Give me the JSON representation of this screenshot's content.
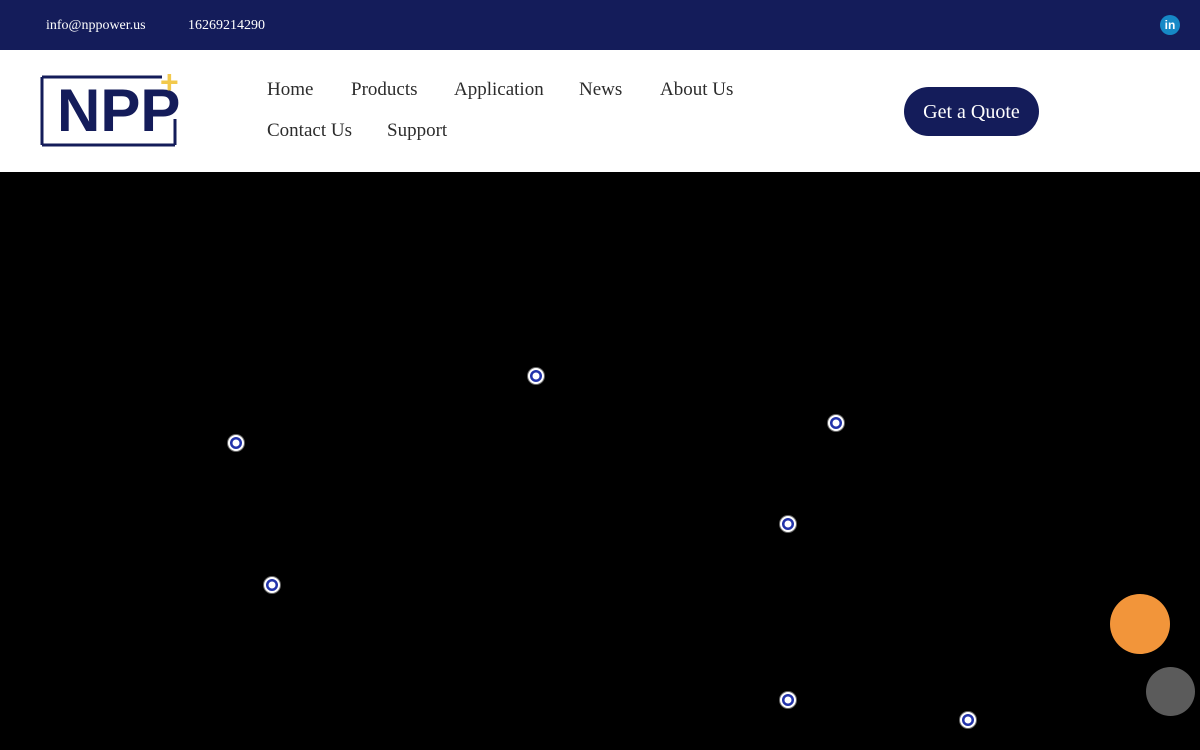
{
  "topbar": {
    "email": "info@nppower.us",
    "phone": "16269214290",
    "social_icon": "linkedin-icon",
    "social_label": "in"
  },
  "brand": {
    "logo_text": "NPP",
    "logo_accent": "+"
  },
  "nav": {
    "items": [
      {
        "label": "Home"
      },
      {
        "label": "Products"
      },
      {
        "label": "Application"
      },
      {
        "label": "News"
      },
      {
        "label": "About Us"
      },
      {
        "label": "Contact Us"
      },
      {
        "label": "Support"
      }
    ]
  },
  "header": {
    "cta_label": "Get a Quote"
  },
  "hero": {
    "hotspot_icon": "hotspot-icon"
  },
  "floating": {
    "primary_icon": "orange-circle-icon",
    "secondary_icon": "gray-circle-icon"
  },
  "colors": {
    "brand_navy": "#141c5a",
    "accent_yellow": "#f2c94c",
    "accent_orange": "#f2953a",
    "linkedin_blue": "#1688c6",
    "hero_background": "#000000"
  }
}
